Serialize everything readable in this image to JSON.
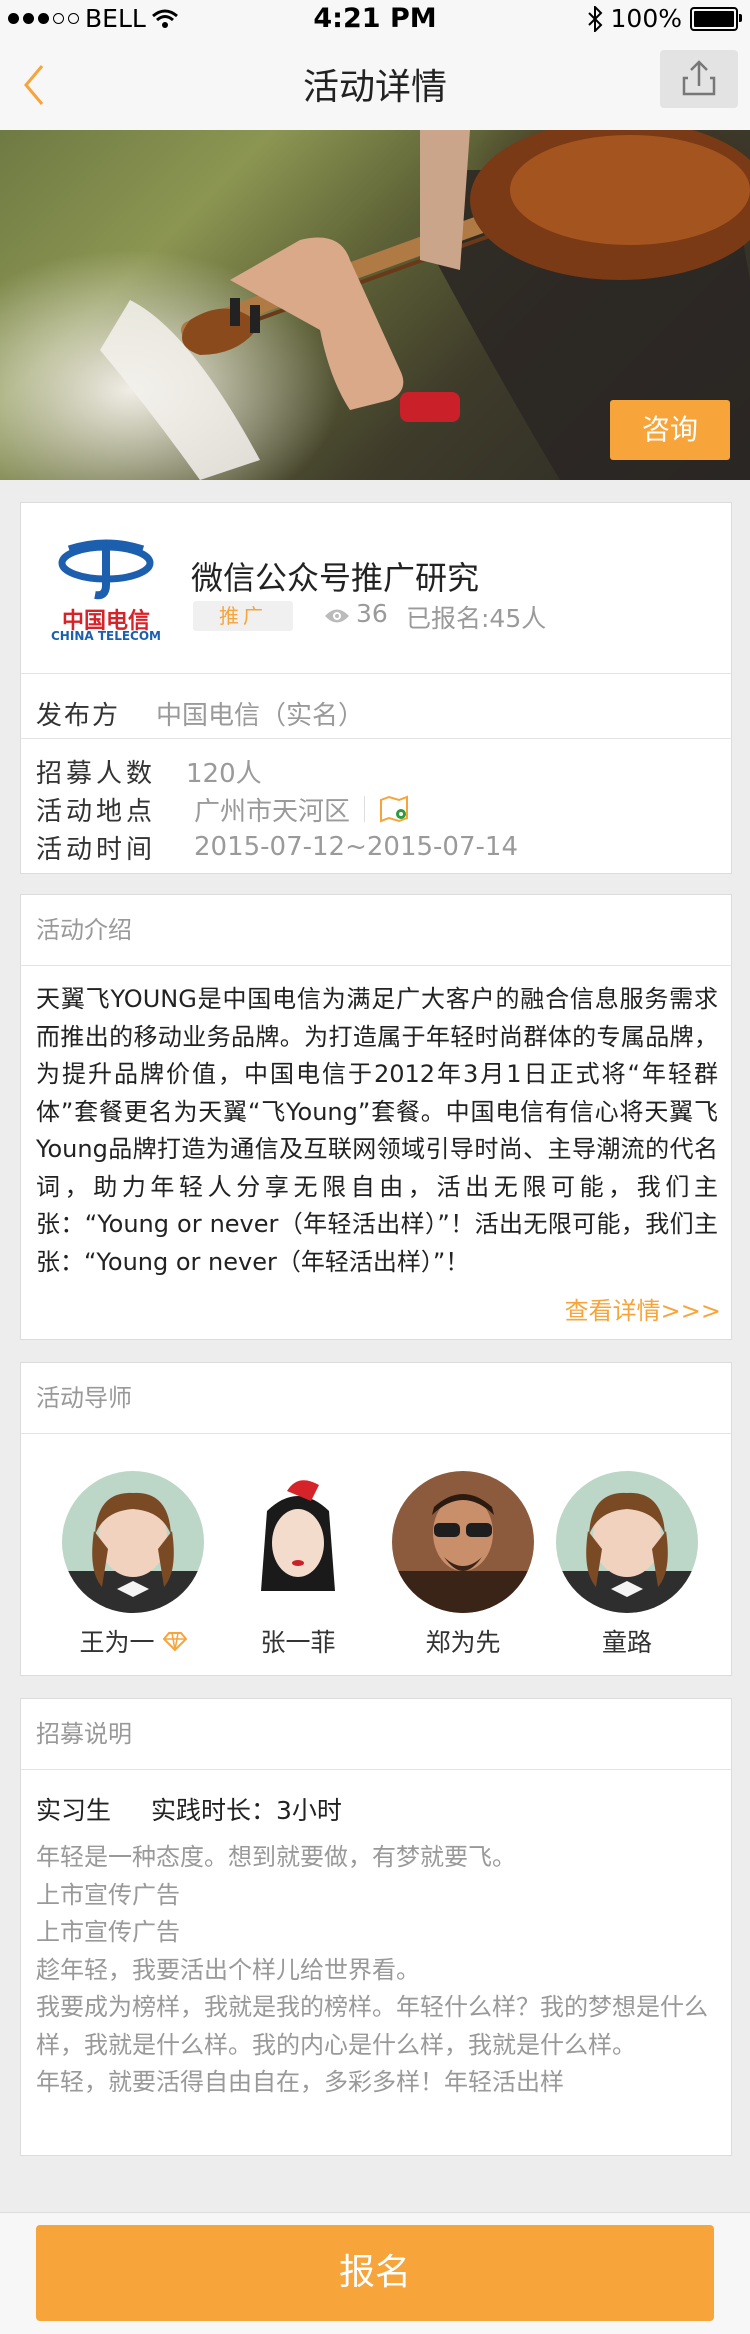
{
  "status": {
    "carrier": "BELL",
    "time": "4:21 PM",
    "battery": "100%"
  },
  "nav": {
    "title": "活动详情"
  },
  "hero": {
    "consult_label": "咨询"
  },
  "org": {
    "logo_text_cn": "中国电信",
    "logo_text_en": "CHINA TELECOM",
    "title": "微信公众号推广研究",
    "tag": "推广",
    "views": "36",
    "signed": "已报名:45人",
    "publisher_label": "发布方",
    "publisher_value": "中国电信（实名）",
    "recruit_label": "招募人数",
    "recruit_value": "120人",
    "location_label": "活动地点",
    "location_value": "广州市天河区",
    "time_label": "活动时间",
    "time_value": "2015-07-12~2015-07-14"
  },
  "intro": {
    "title": "活动介绍",
    "body": "天翼飞YOUNG是中国电信为满足广大客户的融合信息服务需求而推出的移动业务品牌。为打造属于年轻时尚群体的专属品牌，为提升品牌价值，中国电信于2012年3月1日正式将“年轻群体”套餐更名为天翼“飞Young”套餐。中国电信有信心将天翼飞Young品牌打造为通信及互联网领域引导时尚、主导潮流的代名词，助力年轻人分享无限自由，活出无限可能，我们主张：“Young or never（年轻活出样）”！活出无限可能，我们主张：“Young or never（年轻活出样）”！",
    "more": "查看详情>>>"
  },
  "mentors": {
    "title": "活动导师",
    "items": [
      {
        "name": "王为一"
      },
      {
        "name": "张一菲"
      },
      {
        "name": "郑为先"
      },
      {
        "name": "童路"
      }
    ]
  },
  "recruit": {
    "title": "招募说明",
    "role": "实习生",
    "duration": "实践时长：3小时",
    "lines": [
      "年轻是一种态度。想到就要做，有梦就要飞。",
      "上市宣传广告",
      "上市宣传广告",
      "趁年轻，我要活出个样儿给世界看。",
      "我要成为榜样，我就是我的榜样。年轻什么样？我的梦想是什么样，我就是什么样。我的内心是什么样，我就是什么样。",
      "年轻，就要活得自由自在，多彩多样！年轻活出样"
    ]
  },
  "footer": {
    "signup_label": "报名"
  },
  "colors": {
    "accent": "#f7a43a",
    "telecom_blue": "#1b5fae",
    "telecom_red": "#d6232a"
  }
}
